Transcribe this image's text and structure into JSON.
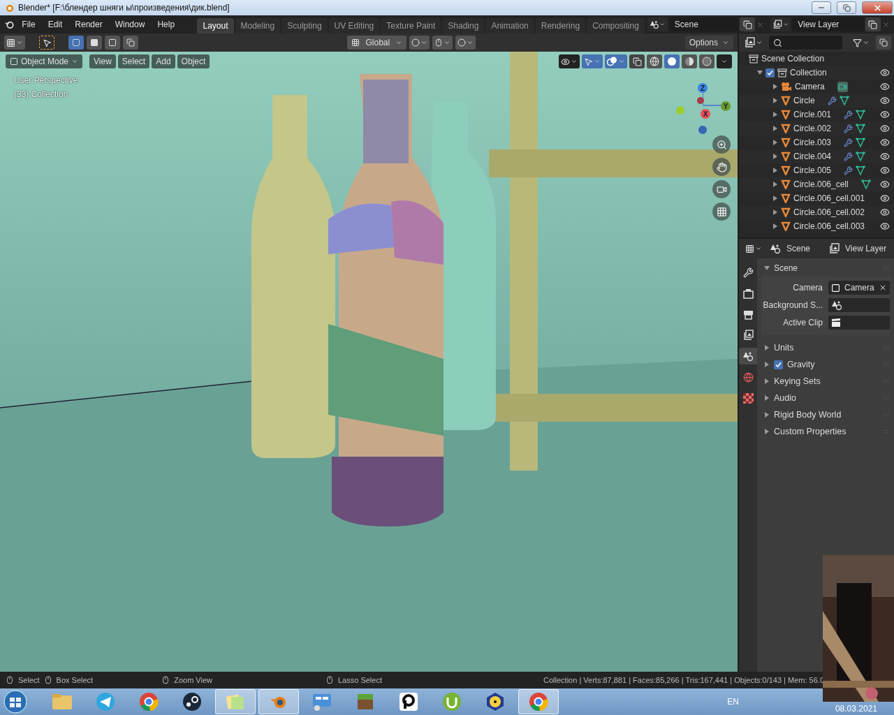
{
  "window": {
    "title": "Blender* [F:\\блендер шняги ы\\произведения\\дик.blend]"
  },
  "menu": [
    "File",
    "Edit",
    "Render",
    "Window",
    "Help"
  ],
  "workspaces": [
    {
      "label": "Layout",
      "selected": true
    },
    {
      "label": "Modeling",
      "selected": false
    },
    {
      "label": "Sculpting",
      "selected": false
    },
    {
      "label": "UV Editing",
      "selected": false
    },
    {
      "label": "Texture Paint",
      "selected": false
    },
    {
      "label": "Shading",
      "selected": false
    },
    {
      "label": "Animation",
      "selected": false
    },
    {
      "label": "Rendering",
      "selected": false
    },
    {
      "label": "Compositing",
      "selected": false
    }
  ],
  "scene_field": "Scene",
  "view_layer_field": "View Layer",
  "tool_header": {
    "orientation": "Global",
    "options": "Options"
  },
  "viewport": {
    "mode": "Object Mode",
    "menus": [
      "View",
      "Select",
      "Add",
      "Object"
    ],
    "info": [
      "User Perspective",
      "(33) Collection"
    ],
    "gizmo": {
      "x": "X",
      "y": "Y",
      "z": "Z"
    },
    "gizmos_on": true,
    "overlays_on": true,
    "shading": [
      {
        "kind": "wire",
        "selected": false
      },
      {
        "kind": "solid",
        "selected": true
      },
      {
        "kind": "material",
        "selected": false
      },
      {
        "kind": "rendered",
        "selected": false
      }
    ]
  },
  "outliner": {
    "root": "Scene Collection",
    "collection": {
      "label": "Collection",
      "checked": true,
      "expanded": true,
      "children": [
        {
          "label": "Camera",
          "kind": "camera",
          "modifier": false,
          "data": true
        },
        {
          "label": "Circle",
          "kind": "mesh",
          "modifier": true,
          "data": true
        },
        {
          "label": "Circle.001",
          "kind": "mesh",
          "modifier": true,
          "data": true
        },
        {
          "label": "Circle.002",
          "kind": "mesh",
          "modifier": true,
          "data": true
        },
        {
          "label": "Circle.003",
          "kind": "mesh",
          "modifier": true,
          "data": true
        },
        {
          "label": "Circle.004",
          "kind": "mesh",
          "modifier": true,
          "data": true
        },
        {
          "label": "Circle.005",
          "kind": "mesh",
          "modifier": true,
          "data": true
        },
        {
          "label": "Circle.006_cell",
          "kind": "mesh",
          "modifier": false,
          "data": true
        },
        {
          "label": "Circle.006_cell.001",
          "kind": "mesh",
          "modifier": false,
          "data": false
        },
        {
          "label": "Circle.006_cell.002",
          "kind": "mesh",
          "modifier": false,
          "data": false
        },
        {
          "label": "Circle.006_cell.003",
          "kind": "mesh",
          "modifier": false,
          "data": false
        }
      ]
    }
  },
  "properties": {
    "tabs": [
      "Scene",
      "View Layer"
    ],
    "side_tabs": [
      {
        "kind": "tool",
        "selected": false
      },
      {
        "kind": "render",
        "selected": false
      },
      {
        "kind": "output",
        "selected": false
      },
      {
        "kind": "view_layer",
        "selected": false
      },
      {
        "kind": "scene",
        "selected": true
      },
      {
        "kind": "world",
        "selected": false
      },
      {
        "kind": "texture",
        "selected": false
      }
    ],
    "panel": {
      "title": "Scene",
      "expanded": true,
      "fields": [
        {
          "label": "Camera",
          "value": "Camera",
          "kind": "camera"
        },
        {
          "label": "Background S...",
          "kind": "scene"
        },
        {
          "label": "Active Clip",
          "kind": "clip"
        }
      ]
    },
    "subpanels": [
      {
        "label": "Units",
        "kind": "plain"
      },
      {
        "label": "Gravity",
        "kind": "check",
        "checked": true
      },
      {
        "label": "Keying Sets",
        "kind": "plain"
      },
      {
        "label": "Audio",
        "kind": "plain"
      },
      {
        "label": "Rigid Body World",
        "kind": "plain"
      },
      {
        "label": "Custom Properties",
        "kind": "plain"
      }
    ]
  },
  "status_bar": {
    "hints": [
      "Select",
      "Box Select",
      "Zoom View",
      "Lasso Select"
    ],
    "stats": "Collection | Verts:87,881 | Faces:85,266 | Tris:167,441 | Objects:0/143 | Mem: 56.0"
  },
  "taskbar": {
    "apps": [
      {
        "kind": "folder",
        "active": false
      },
      {
        "kind": "plane",
        "active": false
      },
      {
        "kind": "chrome",
        "active": false
      },
      {
        "kind": "steam",
        "active": false
      },
      {
        "kind": "notes",
        "active": true
      },
      {
        "kind": "blender",
        "active": true
      },
      {
        "kind": "panel",
        "active": false
      },
      {
        "kind": "block",
        "active": false
      },
      {
        "kind": "ring",
        "active": false
      },
      {
        "kind": "torrent",
        "active": false
      },
      {
        "kind": "hazard",
        "active": false
      },
      {
        "kind": "chrome",
        "active": true
      }
    ],
    "language": "EN",
    "date": "08.03.2021"
  }
}
